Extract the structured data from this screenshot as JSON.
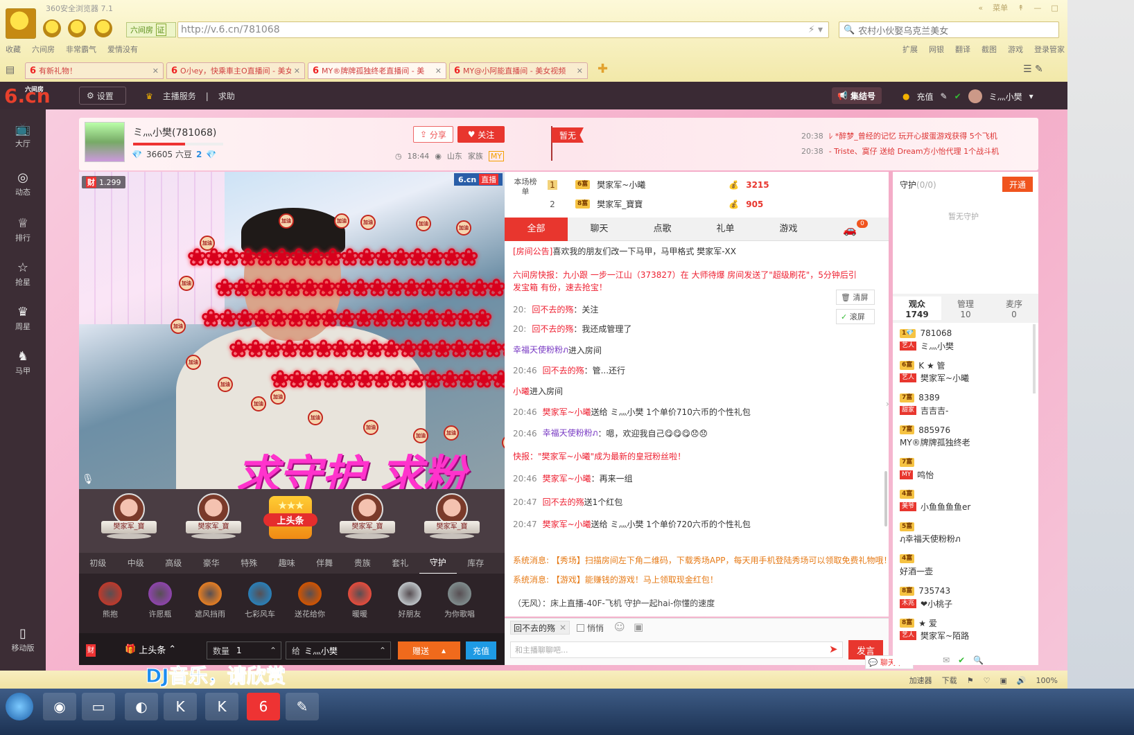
{
  "browser": {
    "title": "360安全浏览器 7.1",
    "window_controls": [
      "«",
      "菜单",
      "↟",
      "—",
      "□",
      "✕"
    ],
    "site_tag": "六间房",
    "site_tag_badge": "证",
    "url": "http://v.6.cn/781068",
    "search_text": "农村小伙娶乌克兰美女",
    "bookmarks": [
      "收藏",
      "六间房",
      "非常霸气",
      "爱情没有"
    ],
    "extensions": [
      "扩展",
      "网银",
      "翻译",
      "截图",
      "游戏",
      "登录管家"
    ],
    "tabs": [
      {
        "label": "有新礼物！",
        "active": false
      },
      {
        "label": "O小ey，快乘車主O直播间 - 美女",
        "active": false
      },
      {
        "label": "MY®牌牌孤独终老直播间 - 美",
        "active": true
      },
      {
        "label": "MY@小阿能直播间 - 美女视频",
        "active": false
      }
    ]
  },
  "site": {
    "logo_main": "6.cn",
    "logo_sub": "六间房",
    "settings_label": "设置",
    "header_links": [
      "主播服务",
      "|",
      "求助"
    ],
    "jihao_label": "集结号",
    "recharge_label": "充值",
    "username": "ミ灬小樊"
  },
  "sidebar": [
    {
      "icon": "📺",
      "label": "大厅"
    },
    {
      "icon": "◎",
      "label": "动态"
    },
    {
      "icon": "♕",
      "label": "排行"
    },
    {
      "icon": "☆",
      "label": "抢星"
    },
    {
      "icon": "♛",
      "label": "周星"
    },
    {
      "icon": "♞",
      "label": "马甲"
    },
    {
      "icon": "▯",
      "label": "移动版"
    }
  ],
  "anchor": {
    "name": "ミ灬小樊(781068)",
    "coins": "36605 六豆",
    "level": "2",
    "level_progress": 0.58,
    "share_label": "分享",
    "follow_label": "关注",
    "time": "18:44",
    "location": "山东",
    "family_label": "家族",
    "family_badge": "MY",
    "flag_label": "暂无"
  },
  "notices": [
    {
      "time": "20:38",
      "text": "ﾚ *醉梦_曾经的记忆 玩开心拔蛋游戏获得 5个飞机"
    },
    {
      "time": "20:38",
      "text": "- Triste、寞仔 送给 Dream方小怡代理 1个战斗机"
    }
  ],
  "video": {
    "wealth_badge": "财",
    "wealth_value": "1.299",
    "brand": "6.cn",
    "live_label": "直播",
    "overlay_text": "求守护 求粉",
    "rose_text": "❀❀❀❀❀❀❀❀❀❀❀❀❀❀❀❀❀",
    "jiayou": "加油"
  },
  "podium": [
    {
      "name": "樊家军_寶"
    },
    {
      "name": "樊家军_寶"
    },
    {
      "name": "上头条"
    },
    {
      "name": "樊家军_寶"
    },
    {
      "name": "樊家军_寶"
    }
  ],
  "gift_categories": [
    "初级",
    "中级",
    "高级",
    "豪华",
    "特殊",
    "趣味",
    "伴舞",
    "贵族",
    "套礼",
    "守护",
    "库存"
  ],
  "gift_categories_active": "守护",
  "gifts": [
    "熊抱",
    "许愿瓶",
    "遮风挡雨",
    "七彩风车",
    "送花给你",
    "暖暖",
    "好朋友",
    "为你歌唱"
  ],
  "gift_bar": {
    "headline_label": "上头条",
    "qty_label": "数量",
    "qty_value": "1",
    "to_label": "给",
    "to_value": "ミ灬小樊",
    "send_label": "赠送",
    "recharge_label": "充值",
    "wealth_badge": "财"
  },
  "rank": {
    "title": "本场榜单",
    "rows": [
      {
        "pos": "1",
        "level": "6富",
        "name": "樊家军~小曦",
        "score": "3215"
      },
      {
        "pos": "2",
        "level": "8富",
        "name": "樊家军_寶寶",
        "score": "905"
      }
    ]
  },
  "chat_tabs": [
    "全部",
    "聊天",
    "点歌",
    "礼单",
    "游戏"
  ],
  "chat_tabs_active": "全部",
  "car_badge": "0",
  "chat": [
    {
      "time": "",
      "user": "[房间公告]",
      "text": "喜欢我的朋友们改一下马甲，马甲格式 樊家军-XX"
    },
    {
      "time": "",
      "user": "",
      "text": "六间房快报：九小跟 一步一江山（373827）在 大师待爆 房间发送了\"超级刷花\"，5分钟后引"
    },
    {
      "time": "",
      "user": "",
      "text": "发宝箱 有份，速去抢宝！"
    },
    {
      "time": "20:",
      "user": "回不去的殇",
      "text": "：关注"
    },
    {
      "time": "20:",
      "user": "回不去的殇",
      "text": "：我还成管理了"
    },
    {
      "time": "",
      "user": "幸福天使粉粉ภ",
      "text": "进入房间"
    },
    {
      "time": "20:46",
      "user": "回不去的殇",
      "text": "：管...还行"
    },
    {
      "time": "",
      "user": "小曦",
      "text": "进入房间"
    },
    {
      "time": "20:46",
      "user": "樊家军~小曦",
      "text": "送给 ミ灬小樊 1个单价710六币的个性礼包"
    },
    {
      "time": "20:46",
      "user": "幸福天使粉粉ภ",
      "text": "：嗯，欢迎我自己😋😋😋😞😞"
    },
    {
      "time": "",
      "user": "快报",
      "text": "：\"樊家军~小曦\"成为最新的皇冠粉丝啦！"
    },
    {
      "time": "20:46",
      "user": "樊家军~小曦",
      "text": "：再来一组"
    },
    {
      "time": "20:47",
      "user": "回不去的殇",
      "text": "送1个红包"
    },
    {
      "time": "20:47",
      "user": "樊家军~小曦",
      "text": "送给 ミ灬小樊 1个单价720六币的个性礼包"
    }
  ],
  "system_msgs": [
    "系统消息: 【秀场】扫描房间左下角二维码，下载秀场APP，每天用手机登陆秀场可以领取免费礼物哦！",
    "系统消息: 【游戏】能赚钱的游戏！马上领取现金红包！",
    "（无风）：床上直播-40F-飞机 守护一起hai-你懂的速度"
  ],
  "chat_tools": {
    "clear": "清屏",
    "scroll": "滚屏"
  },
  "chat_input": {
    "mention": "回不去的殇",
    "private_label": "悄悄",
    "placeholder": "和主播聊聊吧...",
    "send_label": "发言",
    "bubble_label": "聊天中..."
  },
  "guard": {
    "title": "守护",
    "count": "(0/0)",
    "open_label": "开通",
    "empty_label": "暂无守护"
  },
  "audience_tabs": [
    {
      "label": "观众",
      "count": "1749"
    },
    {
      "label": "管理",
      "count": "10"
    },
    {
      "label": "麦序",
      "count": "0"
    }
  ],
  "audience": [
    {
      "level": "1💎",
      "id": "781068",
      "tag": "艺人",
      "name": "ミ灬小樊"
    },
    {
      "level": "6富",
      "id": "K ★ 管",
      "tag": "艺人",
      "name": "樊家军~小曦"
    },
    {
      "level": "7富",
      "id": "8389",
      "tag": "甜家",
      "name": "吉吉吉-"
    },
    {
      "level": "7富",
      "id": "885976",
      "tag": "",
      "name": "MY®牌牌孤独终老"
    },
    {
      "level": "7富",
      "id": "",
      "tag": "MY",
      "name": "鸣怡"
    },
    {
      "level": "4富",
      "id": "",
      "tag": "美爷",
      "name": "小鱼鱼鱼鱼er"
    },
    {
      "level": "5富",
      "id": "",
      "tag": "",
      "name": "ฦ幸福天使粉粉ภ"
    },
    {
      "level": "4富",
      "id": "",
      "tag": "",
      "name": "好酒一壶"
    },
    {
      "level": "8富",
      "id": "735743",
      "tag": "木兆",
      "name": "❤小桃子"
    },
    {
      "level": "8富",
      "id": "★ 爱",
      "tag": "艺人",
      "name": "樊家军~陌路"
    }
  ],
  "status_bar": {
    "dj_text": "DJ音乐，请欣赏",
    "items": [
      "加速器",
      "下载",
      "⚑",
      "♡",
      "▣",
      "🔊",
      "100%"
    ]
  },
  "colors": {
    "accent": "#e8362e",
    "brand_bg": "#3a2a34",
    "pink_bg": "#f4a9c6"
  }
}
